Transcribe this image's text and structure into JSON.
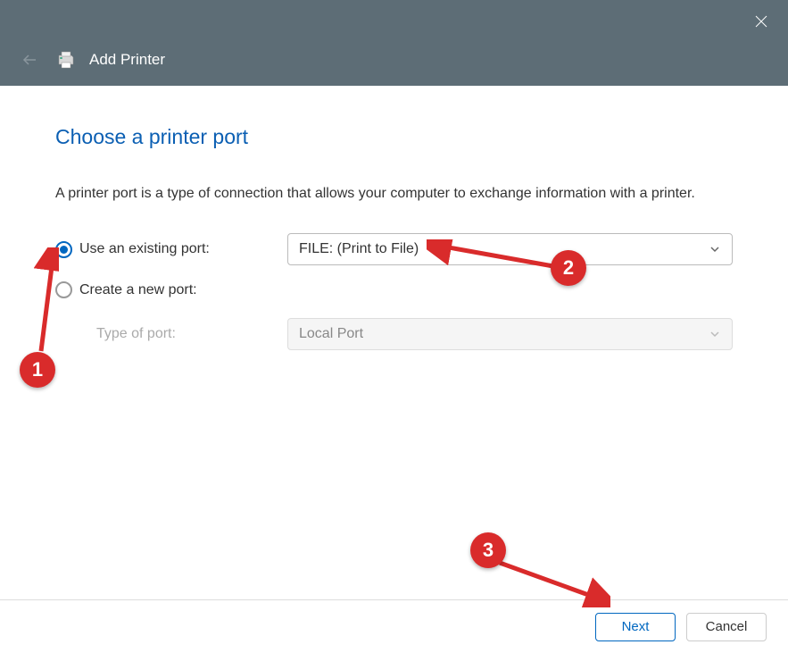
{
  "header": {
    "title": "Add Printer"
  },
  "page": {
    "title": "Choose a printer port",
    "description": "A printer port is a type of connection that allows your computer to exchange information with a printer."
  },
  "options": {
    "existing": {
      "label": "Use an existing port:",
      "value": "FILE: (Print to File)",
      "selected": true
    },
    "create": {
      "label": "Create a new port:",
      "sublabel": "Type of port:",
      "value": "Local Port",
      "selected": false
    }
  },
  "footer": {
    "next": "Next",
    "cancel": "Cancel"
  },
  "annotations": {
    "badge1": "1",
    "badge2": "2",
    "badge3": "3"
  }
}
